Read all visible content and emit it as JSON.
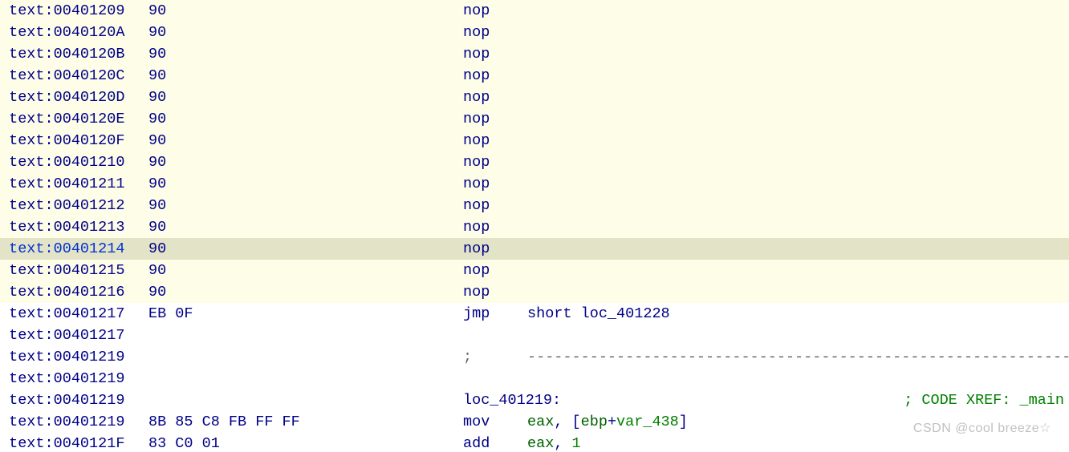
{
  "segment_prefix": "text:",
  "watermark": "CSDN @cool breeze☆",
  "colors": {
    "cream_bg": "#fdfde8",
    "selected_bg": "#e2e3c7",
    "addr_hex_mnem": "#000088",
    "register_var": "#008000",
    "comment": "#008000"
  },
  "rows": [
    {
      "addr": "00401209",
      "hex": "90",
      "mnem": "nop",
      "ops": [],
      "bg": "cream",
      "sel": false
    },
    {
      "addr": "0040120A",
      "hex": "90",
      "mnem": "nop",
      "ops": [],
      "bg": "cream",
      "sel": false
    },
    {
      "addr": "0040120B",
      "hex": "90",
      "mnem": "nop",
      "ops": [],
      "bg": "cream",
      "sel": false
    },
    {
      "addr": "0040120C",
      "hex": "90",
      "mnem": "nop",
      "ops": [],
      "bg": "cream",
      "sel": false
    },
    {
      "addr": "0040120D",
      "hex": "90",
      "mnem": "nop",
      "ops": [],
      "bg": "cream",
      "sel": false
    },
    {
      "addr": "0040120E",
      "hex": "90",
      "mnem": "nop",
      "ops": [],
      "bg": "cream",
      "sel": false
    },
    {
      "addr": "0040120F",
      "hex": "90",
      "mnem": "nop",
      "ops": [],
      "bg": "cream",
      "sel": false
    },
    {
      "addr": "00401210",
      "hex": "90",
      "mnem": "nop",
      "ops": [],
      "bg": "cream",
      "sel": false
    },
    {
      "addr": "00401211",
      "hex": "90",
      "mnem": "nop",
      "ops": [],
      "bg": "cream",
      "sel": false
    },
    {
      "addr": "00401212",
      "hex": "90",
      "mnem": "nop",
      "ops": [],
      "bg": "cream",
      "sel": false
    },
    {
      "addr": "00401213",
      "hex": "90",
      "mnem": "nop",
      "ops": [],
      "bg": "cream",
      "sel": false
    },
    {
      "addr": "00401214",
      "hex": "90",
      "mnem": "nop",
      "ops": [],
      "bg": "sel",
      "sel": true
    },
    {
      "addr": "00401215",
      "hex": "90",
      "mnem": "nop",
      "ops": [],
      "bg": "cream",
      "sel": false
    },
    {
      "addr": "00401216",
      "hex": "90",
      "mnem": "nop",
      "ops": [],
      "bg": "cream",
      "sel": false
    },
    {
      "addr": "00401217",
      "hex": "EB 0F",
      "mnem": "jmp",
      "ops": [
        {
          "t": "short ",
          "c": "op"
        },
        {
          "t": "loc_401228",
          "c": "op"
        }
      ],
      "bg": "white",
      "sel": false
    },
    {
      "addr": "00401217",
      "hex": "",
      "mnem": "",
      "ops": [],
      "bg": "white",
      "sel": false
    },
    {
      "addr": "00401219",
      "hex": "",
      "mnem": ";",
      "sep": true,
      "ops": [],
      "bg": "white",
      "sel": false
    },
    {
      "addr": "00401219",
      "hex": "",
      "mnem": "",
      "ops": [],
      "bg": "white",
      "sel": false
    },
    {
      "addr": "00401219",
      "hex": "",
      "mnem": "",
      "label": "loc_401219:",
      "right_comment": "; CODE XREF: _main",
      "bg": "white",
      "sel": false
    },
    {
      "addr": "00401219",
      "hex": "8B 85 C8 FB FF FF",
      "mnem": "mov",
      "ops": [
        {
          "t": "eax",
          "c": "reg"
        },
        {
          "t": ", [",
          "c": "op"
        },
        {
          "t": "ebp",
          "c": "reg"
        },
        {
          "t": "+",
          "c": "op"
        },
        {
          "t": "var_438",
          "c": "var"
        },
        {
          "t": "]",
          "c": "op"
        }
      ],
      "bg": "white",
      "sel": false
    },
    {
      "addr": "0040121F",
      "hex": "83 C0 01",
      "mnem": "add",
      "ops": [
        {
          "t": "eax",
          "c": "reg"
        },
        {
          "t": ", ",
          "c": "op"
        },
        {
          "t": "1",
          "c": "num"
        }
      ],
      "bg": "white",
      "sel": false,
      "partial": true
    }
  ]
}
